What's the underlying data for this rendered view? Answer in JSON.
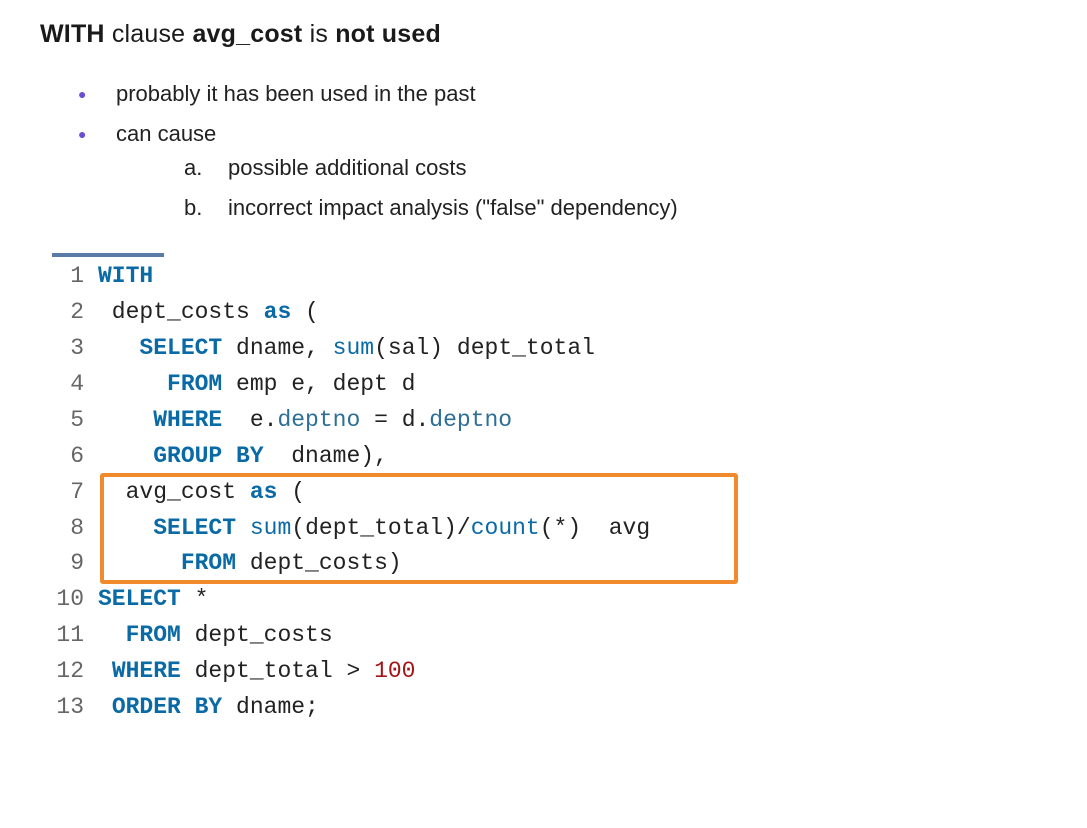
{
  "heading": {
    "part1": "WITH",
    "part2": " clause ",
    "part3": "avg_cost",
    "part4": " is ",
    "part5": "not used"
  },
  "bullets": {
    "b1": "probably it has been used in the past",
    "b2": "can cause",
    "a1": "possible additional costs",
    "a2": "incorrect  impact analysis (\"false\" dependency)"
  },
  "code": {
    "lines": [
      {
        "n": "1",
        "tokens": [
          {
            "t": "WITH",
            "c": "kw"
          }
        ]
      },
      {
        "n": "2",
        "tokens": [
          {
            "t": " dept_costs ",
            "c": ""
          },
          {
            "t": "as",
            "c": "kw"
          },
          {
            "t": " (",
            "c": ""
          }
        ]
      },
      {
        "n": "3",
        "tokens": [
          {
            "t": "   ",
            "c": ""
          },
          {
            "t": "SELECT",
            "c": "kw"
          },
          {
            "t": " dname, ",
            "c": ""
          },
          {
            "t": "sum",
            "c": "fn"
          },
          {
            "t": "(sal) dept_total",
            "c": ""
          }
        ]
      },
      {
        "n": "4",
        "tokens": [
          {
            "t": "     ",
            "c": ""
          },
          {
            "t": "FROM",
            "c": "kw"
          },
          {
            "t": " emp e, dept d",
            "c": ""
          }
        ]
      },
      {
        "n": "5",
        "tokens": [
          {
            "t": "    ",
            "c": ""
          },
          {
            "t": "WHERE",
            "c": "kw"
          },
          {
            "t": "  e.",
            "c": ""
          },
          {
            "t": "deptno",
            "c": "id2"
          },
          {
            "t": " = d.",
            "c": ""
          },
          {
            "t": "deptno",
            "c": "id2"
          }
        ]
      },
      {
        "n": "6",
        "tokens": [
          {
            "t": "    ",
            "c": ""
          },
          {
            "t": "GROUP BY",
            "c": "kw"
          },
          {
            "t": "  dname),",
            "c": ""
          }
        ]
      },
      {
        "n": "7",
        "tokens": [
          {
            "t": "  avg_cost ",
            "c": ""
          },
          {
            "t": "as",
            "c": "kw"
          },
          {
            "t": " (",
            "c": ""
          }
        ]
      },
      {
        "n": "8",
        "tokens": [
          {
            "t": "    ",
            "c": ""
          },
          {
            "t": "SELECT",
            "c": "kw"
          },
          {
            "t": " ",
            "c": ""
          },
          {
            "t": "sum",
            "c": "fn"
          },
          {
            "t": "(dept_total)/",
            "c": ""
          },
          {
            "t": "count",
            "c": "fn"
          },
          {
            "t": "(*)  avg",
            "c": ""
          }
        ]
      },
      {
        "n": "9",
        "tokens": [
          {
            "t": "      ",
            "c": ""
          },
          {
            "t": "FROM",
            "c": "kw"
          },
          {
            "t": " dept_costs)",
            "c": ""
          }
        ]
      },
      {
        "n": "10",
        "tokens": [
          {
            "t": "SELECT",
            "c": "kw"
          },
          {
            "t": " *",
            "c": ""
          }
        ]
      },
      {
        "n": "11",
        "tokens": [
          {
            "t": "  ",
            "c": ""
          },
          {
            "t": "FROM",
            "c": "kw"
          },
          {
            "t": " dept_costs",
            "c": ""
          }
        ]
      },
      {
        "n": "12",
        "tokens": [
          {
            "t": " ",
            "c": ""
          },
          {
            "t": "WHERE",
            "c": "kw"
          },
          {
            "t": " dept_total > ",
            "c": ""
          },
          {
            "t": "100",
            "c": "num"
          }
        ]
      },
      {
        "n": "13",
        "tokens": [
          {
            "t": " ",
            "c": ""
          },
          {
            "t": "ORDER BY",
            "c": "kw"
          },
          {
            "t": " dname;",
            "c": ""
          }
        ]
      }
    ],
    "highlight": {
      "fromLine": 7,
      "toLine": 9
    }
  }
}
